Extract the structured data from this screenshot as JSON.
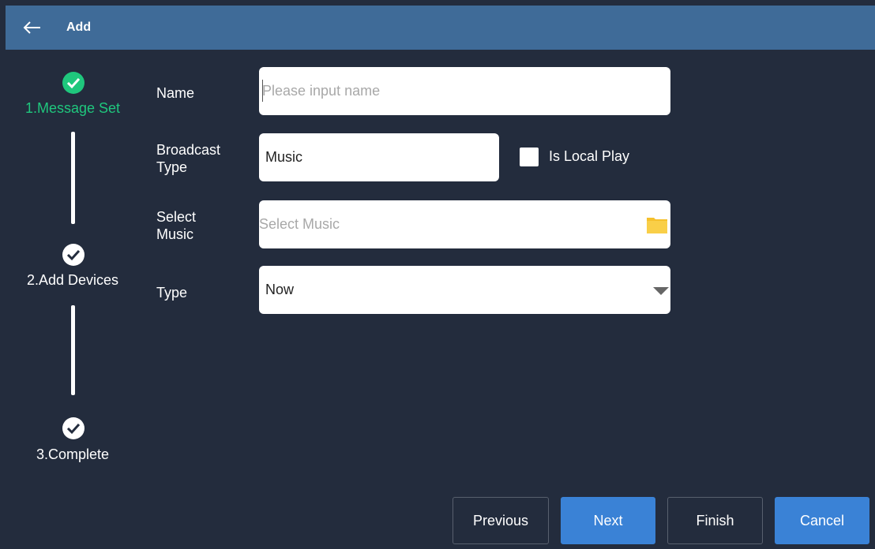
{
  "header": {
    "title": "Add",
    "back_icon": "arrow-left-icon",
    "color": "#3f6b98"
  },
  "stepper": {
    "steps": [
      {
        "label": "1.Message Set",
        "state": "active",
        "color": "#1fc77d"
      },
      {
        "label": "2.Add Devices",
        "state": "pending"
      },
      {
        "label": "3.Complete",
        "state": "pending"
      }
    ]
  },
  "form": {
    "name": {
      "label": "Name",
      "value": "",
      "placeholder": "Please input name"
    },
    "broadcast_type": {
      "label_line1": "Broadcast",
      "label_line2": "Type",
      "value": "Music"
    },
    "local_play": {
      "label": "Is Local Play",
      "checked": false
    },
    "select_music": {
      "label_line1": "Select",
      "label_line2": "Music",
      "placeholder": "Select Music",
      "icon": "folder-icon"
    },
    "type": {
      "label": "Type",
      "value": "Now",
      "icon": "dropdown-arrow-icon"
    }
  },
  "buttons": {
    "previous": "Previous",
    "next": "Next",
    "finish": "Finish",
    "cancel": "Cancel"
  },
  "colors": {
    "background": "#232c3d",
    "accent": "#3a82d6",
    "success": "#1fc77d"
  }
}
